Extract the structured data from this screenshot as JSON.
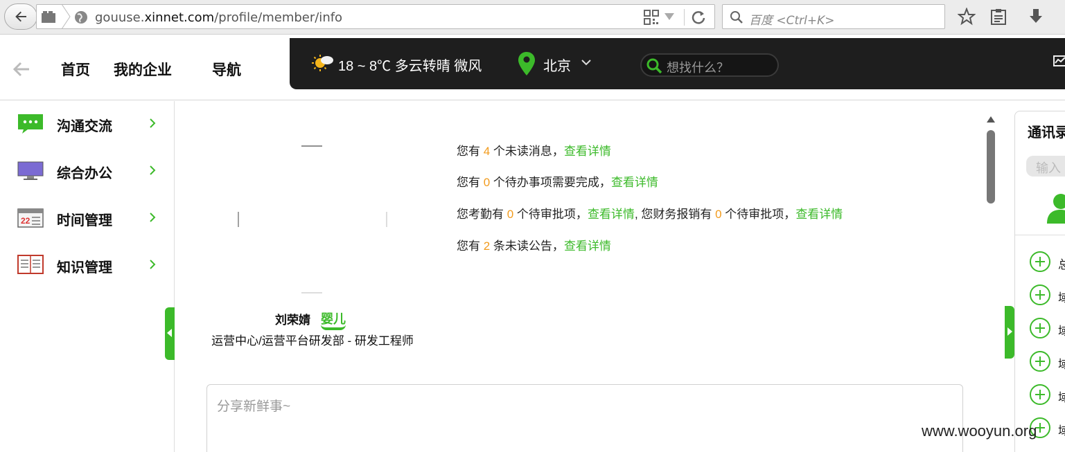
{
  "browser": {
    "url_prefix": "gouuse.",
    "url_domain": "xinnet.com",
    "url_path": "/profile/member/info",
    "search_placeholder": "百度 <Ctrl+K>"
  },
  "header": {
    "nav": [
      "首页",
      "我的企业",
      "导航"
    ],
    "weather": "18 ~ 8℃  多云转晴  微风",
    "city": "北京",
    "search_placeholder": "想找什么？"
  },
  "sidebar": {
    "items": [
      {
        "label": "沟通交流",
        "icon": "chat-icon"
      },
      {
        "label": "综合办公",
        "icon": "monitor-icon"
      },
      {
        "label": "时间管理",
        "icon": "calendar-icon"
      },
      {
        "label": "知识管理",
        "icon": "book-icon"
      }
    ]
  },
  "profile": {
    "name": "刘荣婧",
    "nickname": "婴儿",
    "department": "运营中心/运营平台研发部 - 研发工程师"
  },
  "notices": {
    "line1": {
      "pre": "您有 ",
      "num": "4",
      "post": " 个未读消息，",
      "link": "查看详情"
    },
    "line2": {
      "pre": "您有 ",
      "num": "0",
      "post": " 个待办事项需要完成，",
      "link": "查看详情"
    },
    "line3": {
      "pre": "您考勤有 ",
      "num": "0",
      "mid": " 个待审批项，",
      "link": "查看详情",
      "mid2": ", 您财务报销有 ",
      "num2": "0",
      "post2": " 个待审批项，",
      "link2": "查看详情"
    },
    "line4": {
      "pre": "您有 ",
      "num": "2",
      "post": " 条未读公告，",
      "link": "查看详情"
    }
  },
  "share": {
    "placeholder": "分享新鲜事~"
  },
  "right_panel": {
    "title": "通讯录",
    "input_placeholder": "输入",
    "items": [
      "总",
      "域",
      "域",
      "域",
      "域",
      "域"
    ]
  },
  "watermark": "www.wooyun.org",
  "colors": {
    "accent": "#3cba2a",
    "number": "#f29b1d",
    "header_dark": "#1e1e1e"
  }
}
